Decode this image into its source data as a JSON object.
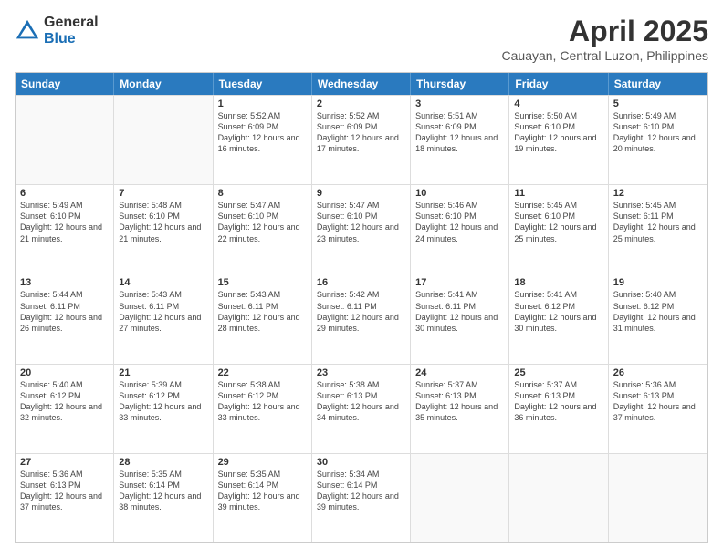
{
  "logo": {
    "general": "General",
    "blue": "Blue"
  },
  "title": "April 2025",
  "location": "Cauayan, Central Luzon, Philippines",
  "days": [
    "Sunday",
    "Monday",
    "Tuesday",
    "Wednesday",
    "Thursday",
    "Friday",
    "Saturday"
  ],
  "rows": [
    [
      {
        "day": "",
        "empty": true
      },
      {
        "day": "",
        "empty": true
      },
      {
        "day": "1",
        "rise": "Sunrise: 5:52 AM",
        "set": "Sunset: 6:09 PM",
        "day_hours": "Daylight: 12 hours and 16 minutes."
      },
      {
        "day": "2",
        "rise": "Sunrise: 5:52 AM",
        "set": "Sunset: 6:09 PM",
        "day_hours": "Daylight: 12 hours and 17 minutes."
      },
      {
        "day": "3",
        "rise": "Sunrise: 5:51 AM",
        "set": "Sunset: 6:09 PM",
        "day_hours": "Daylight: 12 hours and 18 minutes."
      },
      {
        "day": "4",
        "rise": "Sunrise: 5:50 AM",
        "set": "Sunset: 6:10 PM",
        "day_hours": "Daylight: 12 hours and 19 minutes."
      },
      {
        "day": "5",
        "rise": "Sunrise: 5:49 AM",
        "set": "Sunset: 6:10 PM",
        "day_hours": "Daylight: 12 hours and 20 minutes."
      }
    ],
    [
      {
        "day": "6",
        "rise": "Sunrise: 5:49 AM",
        "set": "Sunset: 6:10 PM",
        "day_hours": "Daylight: 12 hours and 21 minutes."
      },
      {
        "day": "7",
        "rise": "Sunrise: 5:48 AM",
        "set": "Sunset: 6:10 PM",
        "day_hours": "Daylight: 12 hours and 21 minutes."
      },
      {
        "day": "8",
        "rise": "Sunrise: 5:47 AM",
        "set": "Sunset: 6:10 PM",
        "day_hours": "Daylight: 12 hours and 22 minutes."
      },
      {
        "day": "9",
        "rise": "Sunrise: 5:47 AM",
        "set": "Sunset: 6:10 PM",
        "day_hours": "Daylight: 12 hours and 23 minutes."
      },
      {
        "day": "10",
        "rise": "Sunrise: 5:46 AM",
        "set": "Sunset: 6:10 PM",
        "day_hours": "Daylight: 12 hours and 24 minutes."
      },
      {
        "day": "11",
        "rise": "Sunrise: 5:45 AM",
        "set": "Sunset: 6:10 PM",
        "day_hours": "Daylight: 12 hours and 25 minutes."
      },
      {
        "day": "12",
        "rise": "Sunrise: 5:45 AM",
        "set": "Sunset: 6:11 PM",
        "day_hours": "Daylight: 12 hours and 25 minutes."
      }
    ],
    [
      {
        "day": "13",
        "rise": "Sunrise: 5:44 AM",
        "set": "Sunset: 6:11 PM",
        "day_hours": "Daylight: 12 hours and 26 minutes."
      },
      {
        "day": "14",
        "rise": "Sunrise: 5:43 AM",
        "set": "Sunset: 6:11 PM",
        "day_hours": "Daylight: 12 hours and 27 minutes."
      },
      {
        "day": "15",
        "rise": "Sunrise: 5:43 AM",
        "set": "Sunset: 6:11 PM",
        "day_hours": "Daylight: 12 hours and 28 minutes."
      },
      {
        "day": "16",
        "rise": "Sunrise: 5:42 AM",
        "set": "Sunset: 6:11 PM",
        "day_hours": "Daylight: 12 hours and 29 minutes."
      },
      {
        "day": "17",
        "rise": "Sunrise: 5:41 AM",
        "set": "Sunset: 6:11 PM",
        "day_hours": "Daylight: 12 hours and 30 minutes."
      },
      {
        "day": "18",
        "rise": "Sunrise: 5:41 AM",
        "set": "Sunset: 6:12 PM",
        "day_hours": "Daylight: 12 hours and 30 minutes."
      },
      {
        "day": "19",
        "rise": "Sunrise: 5:40 AM",
        "set": "Sunset: 6:12 PM",
        "day_hours": "Daylight: 12 hours and 31 minutes."
      }
    ],
    [
      {
        "day": "20",
        "rise": "Sunrise: 5:40 AM",
        "set": "Sunset: 6:12 PM",
        "day_hours": "Daylight: 12 hours and 32 minutes."
      },
      {
        "day": "21",
        "rise": "Sunrise: 5:39 AM",
        "set": "Sunset: 6:12 PM",
        "day_hours": "Daylight: 12 hours and 33 minutes."
      },
      {
        "day": "22",
        "rise": "Sunrise: 5:38 AM",
        "set": "Sunset: 6:12 PM",
        "day_hours": "Daylight: 12 hours and 33 minutes."
      },
      {
        "day": "23",
        "rise": "Sunrise: 5:38 AM",
        "set": "Sunset: 6:13 PM",
        "day_hours": "Daylight: 12 hours and 34 minutes."
      },
      {
        "day": "24",
        "rise": "Sunrise: 5:37 AM",
        "set": "Sunset: 6:13 PM",
        "day_hours": "Daylight: 12 hours and 35 minutes."
      },
      {
        "day": "25",
        "rise": "Sunrise: 5:37 AM",
        "set": "Sunset: 6:13 PM",
        "day_hours": "Daylight: 12 hours and 36 minutes."
      },
      {
        "day": "26",
        "rise": "Sunrise: 5:36 AM",
        "set": "Sunset: 6:13 PM",
        "day_hours": "Daylight: 12 hours and 37 minutes."
      }
    ],
    [
      {
        "day": "27",
        "rise": "Sunrise: 5:36 AM",
        "set": "Sunset: 6:13 PM",
        "day_hours": "Daylight: 12 hours and 37 minutes."
      },
      {
        "day": "28",
        "rise": "Sunrise: 5:35 AM",
        "set": "Sunset: 6:14 PM",
        "day_hours": "Daylight: 12 hours and 38 minutes."
      },
      {
        "day": "29",
        "rise": "Sunrise: 5:35 AM",
        "set": "Sunset: 6:14 PM",
        "day_hours": "Daylight: 12 hours and 39 minutes."
      },
      {
        "day": "30",
        "rise": "Sunrise: 5:34 AM",
        "set": "Sunset: 6:14 PM",
        "day_hours": "Daylight: 12 hours and 39 minutes."
      },
      {
        "day": "",
        "empty": true
      },
      {
        "day": "",
        "empty": true
      },
      {
        "day": "",
        "empty": true
      }
    ]
  ]
}
